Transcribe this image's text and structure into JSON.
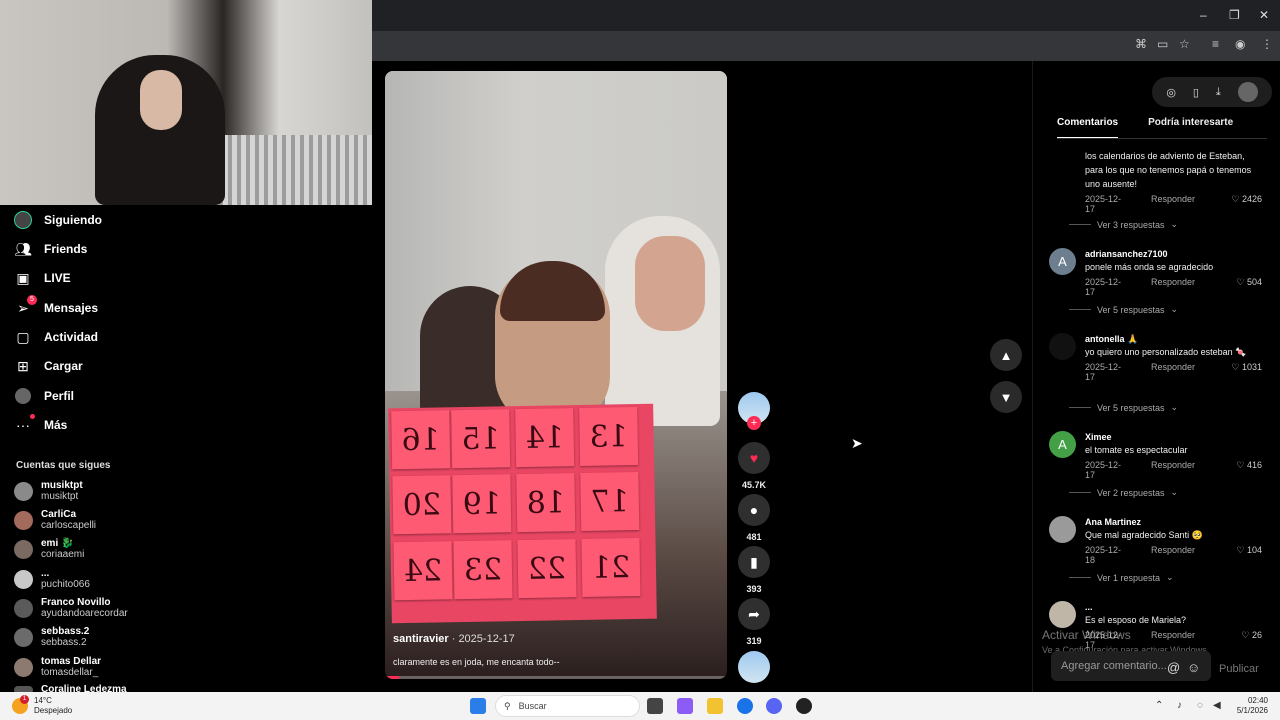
{
  "window": {
    "minimize": "–",
    "restore": "❐",
    "close": "✕"
  },
  "toolbar_icons": [
    "translate-icon",
    "cast-icon",
    "star-icon",
    "playlist-icon",
    "profile-icon",
    "menu-icon"
  ],
  "sidebar": {
    "nav": [
      {
        "id": "siguiendo",
        "label": "Siguiendo",
        "icon": "avatar-icon"
      },
      {
        "id": "friends",
        "label": "Friends",
        "icon": "friends-icon"
      },
      {
        "id": "live",
        "label": "LIVE",
        "icon": "live-icon"
      },
      {
        "id": "mensajes",
        "label": "Mensajes",
        "icon": "messages-icon",
        "badge": "5"
      },
      {
        "id": "actividad",
        "label": "Actividad",
        "icon": "activity-icon"
      },
      {
        "id": "cargar",
        "label": "Cargar",
        "icon": "upload-icon"
      },
      {
        "id": "perfil",
        "label": "Perfil",
        "icon": "profile-avatar-icon"
      },
      {
        "id": "mas",
        "label": "Más",
        "icon": "more-icon"
      }
    ],
    "following_title": "Cuentas que sigues",
    "accounts": [
      {
        "name": "musiktpt",
        "handle": "musiktpt"
      },
      {
        "name": "CarliCa",
        "handle": "carloscapelli"
      },
      {
        "name": "emi 🐉",
        "handle": "coriaaemi"
      },
      {
        "name": "...",
        "handle": "puchito066"
      },
      {
        "name": "Franco Novillo",
        "handle": "ayudandoarecordar"
      },
      {
        "name": "sebbass.2",
        "handle": "sebbass.2"
      },
      {
        "name": "tomas Dellar",
        "handle": "tomasdellar_"
      },
      {
        "name": "Coraline Ledezma",
        "handle": ""
      }
    ]
  },
  "video": {
    "username": "santiravier",
    "date": "· 2025-12-17",
    "caption": "claramente es en joda, me encanta todo--",
    "progress": 0.04,
    "calendar": [
      "13",
      "14",
      "15",
      "16",
      "17",
      "18",
      "19",
      "20",
      "21",
      "22",
      "23",
      "24"
    ],
    "likes": "45.7K",
    "comments": "481",
    "saves": "393",
    "shares": "319"
  },
  "panel": {
    "tabs": [
      "Comentarios",
      "Podría interesarte"
    ],
    "reply_label": "Responder",
    "partial_comment": {
      "text": "los calendarios de adviento de Esteban, para los que no tenemos papá o tenemos uno ausente!",
      "date": "2025-12-17",
      "likes": "2426",
      "more": "Ver 3 respuestas"
    },
    "comments": [
      {
        "avatar_letter": "A",
        "avatar_color": "#6d7f8f",
        "user": "adriansanchez7100",
        "text": "ponele más onda se agradecido",
        "date": "2025-12-17",
        "likes": "504",
        "more": "Ver 5 respuestas"
      },
      {
        "avatar_letter": "",
        "avatar_color": "#111111",
        "user": "antonella 🙏",
        "text": "yo quiero uno personalizado esteban 🍬",
        "date": "2025-12-17",
        "likes": "1031",
        "more": "Ver 5 respuestas"
      },
      {
        "avatar_letter": "A",
        "avatar_color": "#43a047",
        "user": "Ximee",
        "text": "el tomate es espectacular",
        "date": "2025-12-17",
        "likes": "416",
        "more": "Ver 2 respuestas"
      },
      {
        "avatar_letter": "",
        "avatar_color": "#9a9a9a",
        "user": "Ana Martinez",
        "text": "Que mal agradecido Santi 🥺",
        "date": "2025-12-18",
        "likes": "104",
        "more": "Ver 1 respuesta"
      },
      {
        "avatar_letter": "",
        "avatar_color": "#bfb6a8",
        "user": "...",
        "text": "Es el esposo de Mariela?",
        "date": "2025-12-17",
        "likes": "26",
        "more": ""
      }
    ],
    "comment_placeholder": "Agregar comentario...",
    "publish": "Publicar",
    "watermark_title": "Activar Windows",
    "watermark_sub": "Ve a Configuración para activar Windows."
  },
  "taskbar": {
    "temp": "14°C",
    "weather": "Despejado",
    "weather_badge": "1",
    "search": "Buscar",
    "time": "02:40",
    "date": "5/1/2026"
  },
  "colors": {
    "accent": "#fe2c55",
    "panel_bg": "#000000"
  }
}
